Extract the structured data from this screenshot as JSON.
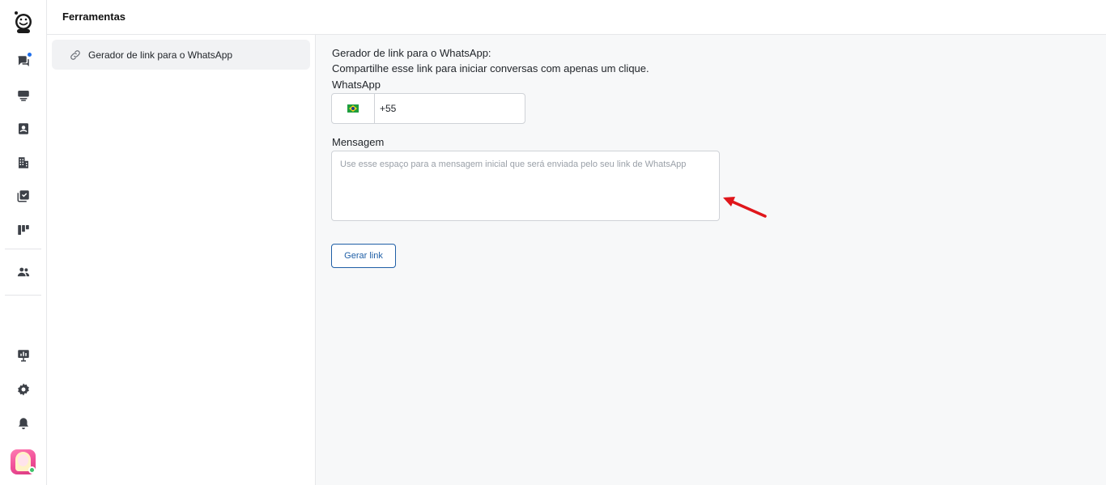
{
  "header": {
    "title": "Ferramentas"
  },
  "panel": {
    "items": [
      {
        "label": "Gerador de link para o WhatsApp"
      }
    ]
  },
  "main": {
    "heading": "Gerador de link para o WhatsApp:",
    "subtitle": "Compartilhe esse link para iniciar conversas com apenas um clique.",
    "whatsapp_label": "WhatsApp",
    "phone_prefix": "+55",
    "message_label": "Mensagem",
    "message_placeholder": "Use esse espaço para a mensagem inicial que será enviada pelo seu link de WhatsApp",
    "generate_button": "Gerar link"
  },
  "rail": {
    "icons": [
      "logo-icon",
      "conversations-icon",
      "inbox-icon",
      "contacts-icon",
      "companies-icon",
      "tasks-icon",
      "kanban-icon",
      "team-icon",
      "dashboard-icon",
      "settings-icon",
      "notifications-icon"
    ],
    "notification_badge_color": "#1f6feb",
    "online_status_color": "#3fc26a"
  },
  "colors": {
    "accent": "#1f5fa6",
    "annotation_arrow": "#e0161b"
  }
}
